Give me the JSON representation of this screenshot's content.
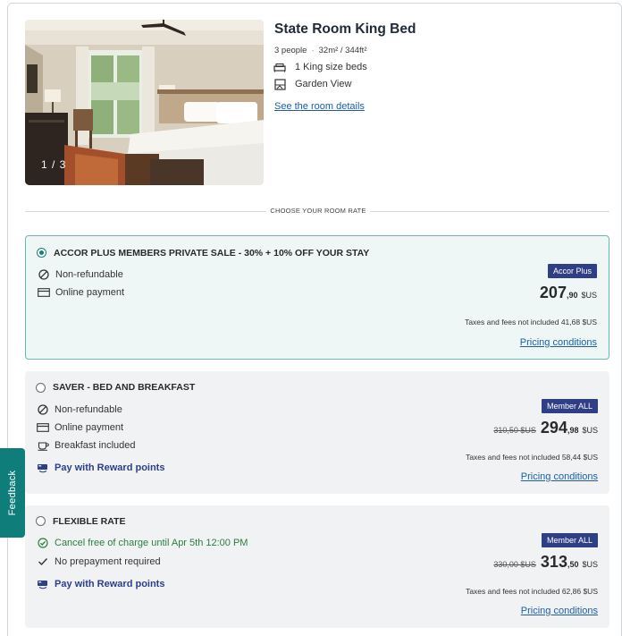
{
  "room": {
    "title": "State Room King Bed",
    "people": "3 people",
    "size": "32m² / 344ft²",
    "bed": "1 King size beds",
    "view": "Garden View",
    "details_link": "See the room details",
    "photo_counter": "1 / 3"
  },
  "section_label": "CHOOSE YOUR ROOM RATE",
  "rates": [
    {
      "title": "ACCOR PLUS MEMBERS PRIVATE SALE - 30% + 10% OFF YOUR STAY",
      "selected": true,
      "conditions": [
        "Non-refundable",
        "Online payment"
      ],
      "badge": "Accor Plus",
      "price_int": "207",
      "price_dec": ",90",
      "currency": "$US",
      "taxes": "Taxes and fees not included 41,68 $US",
      "pricing_link": "Pricing conditions"
    },
    {
      "title": "SAVER - BED AND BREAKFAST",
      "selected": false,
      "conditions": [
        "Non-refundable",
        "Online payment",
        "Breakfast included"
      ],
      "reward": "Pay with Reward points",
      "badge": "Member ALL",
      "old_price": "310,50 $US",
      "price_int": "294",
      "price_dec": ",98",
      "currency": "$US",
      "taxes": "Taxes and fees not included 58,44 $US",
      "pricing_link": "Pricing conditions"
    },
    {
      "title": "FLEXIBLE RATE",
      "selected": false,
      "conditions": [
        "Cancel free of charge until Apr 5th 12:00 PM",
        "No prepayment required"
      ],
      "reward": "Pay with Reward points",
      "badge": "Member ALL",
      "old_price": "330,00 $US",
      "price_int": "313",
      "price_dec": ",50",
      "currency": "$US",
      "taxes": "Taxes and fees not included 62,86 $US",
      "pricing_link": "Pricing conditions"
    }
  ],
  "feedback_label": "Feedback",
  "colors": {
    "accent_teal": "#0f7d79",
    "badge_navy": "#2f3f86",
    "link_blue": "#1c5fa3",
    "selected_bg": "#eef7f6",
    "selected_border": "#67b8b0",
    "card_bg": "#f1f2f4",
    "cancel_green": "#2e7d3e"
  },
  "icons": {
    "non_refundable": "no-entry-icon",
    "online_payment": "credit-card-icon",
    "breakfast": "coffee-cup-icon",
    "reward": "reward-card-icon",
    "cancel_free": "check-circle-icon",
    "no_prepayment": "check-icon",
    "bed": "bed-icon",
    "view": "window-view-icon"
  }
}
